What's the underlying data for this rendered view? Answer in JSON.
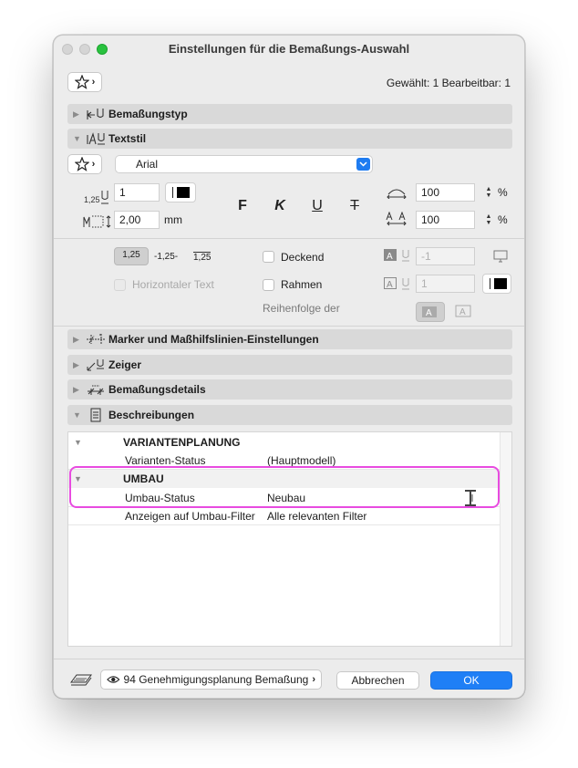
{
  "window": {
    "title": "Einstellungen für die Bemaßungs-Auswahl"
  },
  "header": {
    "selection_info": "Gewählt: 1 Bearbeitbar: 1"
  },
  "sections": {
    "bemassungstyp": "Bemaßungstyp",
    "textstil": "Textstil",
    "marker": "Marker und Maßhilfslinien-Einstellungen",
    "zeiger": "Zeiger",
    "details": "Bemaßungsdetails",
    "beschreibungen": "Beschreibungen"
  },
  "textstil": {
    "font": "Arial",
    "size_value": "1",
    "size_icon_label": "1,25",
    "offset_value": "2,00",
    "offset_unit": "mm",
    "width_value": "100",
    "width_unit": "%",
    "spacing_value": "100",
    "spacing_unit": "%",
    "style_bold": "F",
    "style_italic": "K",
    "style_underline": "U",
    "style_strike": "T"
  },
  "options": {
    "fmt1": "1,25",
    "fmt2": "-1,25-",
    "fmt3": "1,25",
    "horizontal_text": "Horizontaler Text",
    "deckend": "Deckend",
    "rahmen": "Rahmen",
    "reihenfolge": "Reihenfolge der",
    "pen_value_1": "-1",
    "pen_value_2": "1"
  },
  "beschreibungen": {
    "groups": [
      {
        "header": "VARIANTENPLANUNG",
        "rows": [
          {
            "name": "Varianten-Status",
            "value": "(Hauptmodell)"
          }
        ]
      },
      {
        "header": "UMBAU",
        "rows": [
          {
            "name": "Umbau-Status",
            "value": "Neubau"
          },
          {
            "name": "Anzeigen auf Umbau-Filter",
            "value": "Alle relevanten Filter"
          }
        ]
      }
    ]
  },
  "footer": {
    "layer": "94 Genehmigungsplanung Bemaßung",
    "cancel": "Abbrechen",
    "ok": "OK"
  },
  "colors": {
    "accent": "#1f7ff6",
    "highlight": "#e84be0",
    "traffic_green": "#29c23f"
  }
}
